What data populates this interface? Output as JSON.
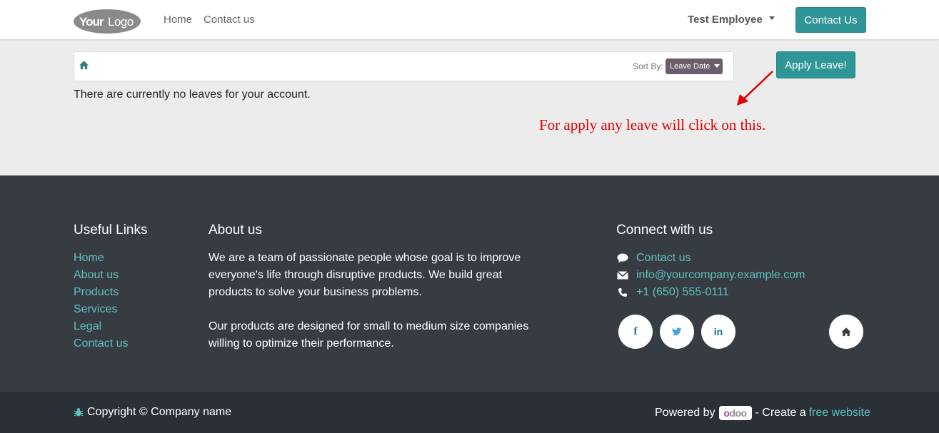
{
  "header": {
    "logo_text": "YourLogo",
    "nav": [
      {
        "label": "Home"
      },
      {
        "label": "Contact us"
      }
    ],
    "user_name": "Test Employee",
    "contact_button": "Contact Us"
  },
  "main": {
    "sort_label": "Sort By:",
    "sort_value": "Leave Date",
    "empty_message": "There are currently no leaves for your account.",
    "apply_button": "Apply Leave!",
    "annotation": "For apply any leave will click on this."
  },
  "footer": {
    "useful_links": {
      "title": "Useful Links",
      "items": [
        "Home",
        "About us",
        "Products",
        "Services",
        "Legal",
        "Contact us"
      ]
    },
    "about": {
      "title": "About us",
      "paragraphs": [
        "We are a team of passionate people whose goal is to improve everyone's life through disruptive products. We build great products to solve your business problems.",
        "Our products are designed for small to medium size companies willing to optimize their performance."
      ]
    },
    "connect": {
      "title": "Connect with us",
      "items": [
        {
          "icon": "comment-icon",
          "label": "Contact us"
        },
        {
          "icon": "envelope-icon",
          "label": "info@yourcompany.example.com"
        },
        {
          "icon": "phone-icon",
          "label": "+1 (650) 555-0111"
        }
      ],
      "social": [
        "facebook-icon",
        "twitter-icon",
        "linkedin-icon",
        "home-icon"
      ]
    }
  },
  "bottom": {
    "copyright": "Copyright © Company name",
    "powered_by": "Powered by",
    "odoo": "odoo",
    "create_a": "- Create a",
    "free_website": "free website"
  },
  "colors": {
    "primary": "#2f9597",
    "link": "#5ec2c1",
    "footer_bg": "#373b42",
    "bottom_bg": "#2b2f36",
    "annotation": "#e00000",
    "sort_badge": "#6c5d6b"
  }
}
